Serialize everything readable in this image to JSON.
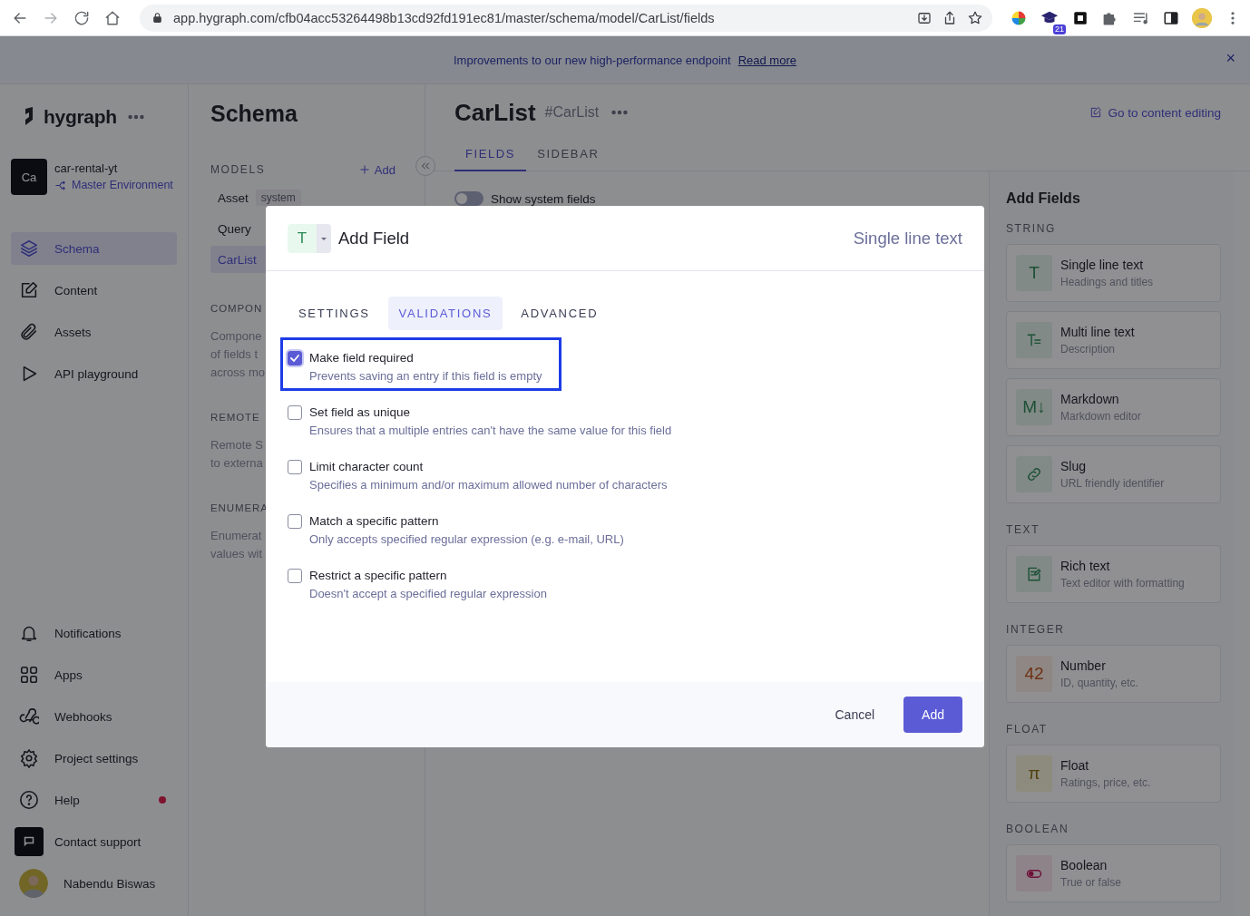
{
  "browser": {
    "url": "app.hygraph.com/cfb04acc53264498b13cd92fd191ec81/master/schema/model/CarList/fields",
    "extension_badge": "21"
  },
  "banner": {
    "text": "Improvements to our new high-performance endpoint",
    "link": "Read more",
    "close": "×"
  },
  "sidebar": {
    "brand": "hygraph",
    "project": {
      "initials": "Ca",
      "name": "car-rental-yt",
      "environment": "Master Environment"
    },
    "nav": [
      {
        "kind": "layers",
        "label": "Schema",
        "selected": true
      },
      {
        "kind": "edit",
        "label": "Content",
        "selected": false
      },
      {
        "kind": "clip",
        "label": "Assets",
        "selected": false
      },
      {
        "kind": "play",
        "label": "API playground",
        "selected": false
      }
    ],
    "footer_nav": [
      {
        "kind": "bell",
        "label": "Notifications",
        "alert": false
      },
      {
        "kind": "apps",
        "label": "Apps",
        "alert": false
      },
      {
        "kind": "webhook",
        "label": "Webhooks",
        "alert": false
      },
      {
        "kind": "gear",
        "label": "Project settings",
        "alert": false
      },
      {
        "kind": "help",
        "label": "Help",
        "alert": true
      },
      {
        "kind": "support",
        "label": "Contact support",
        "alert": false
      }
    ],
    "user": {
      "name": "Nabendu Biswas"
    }
  },
  "schema_panel": {
    "title": "Schema",
    "models_heading": "MODELS",
    "add_label": "Add",
    "models": [
      {
        "name": "Asset",
        "tag": "system",
        "selected": false
      },
      {
        "name": "Query",
        "selected": false
      },
      {
        "name": "CarList",
        "selected": true
      }
    ],
    "sections": [
      {
        "heading": "COMPON",
        "lines": [
          "Compone",
          "of fields t",
          "across mo"
        ]
      },
      {
        "heading": "REMOTE",
        "lines": [
          "Remote S",
          "to externa"
        ]
      },
      {
        "heading": "ENUMERA",
        "lines": [
          "Enumerat",
          "values wit"
        ]
      }
    ]
  },
  "model": {
    "title": "CarList",
    "api_id": "#CarList",
    "content_link": "Go to content editing",
    "tabs": [
      {
        "label": "FIELDS",
        "selected": true
      },
      {
        "label": "SIDEBAR",
        "selected": false
      }
    ],
    "system_fields": {
      "label": "Show system fields",
      "on": false
    }
  },
  "add_fields": {
    "title": "Add Fields",
    "groups": [
      {
        "heading": "STRING",
        "items": [
          {
            "kind": "text",
            "glyph": "T",
            "name": "Single line text",
            "description": "Headings and titles"
          },
          {
            "kind": "multiline",
            "name": "Multi line text",
            "description": "Description"
          },
          {
            "kind": "markdown",
            "glyph": "M↓",
            "name": "Markdown",
            "description": "Markdown editor"
          },
          {
            "kind": "slug",
            "name": "Slug",
            "description": "URL friendly identifier"
          }
        ]
      },
      {
        "heading": "TEXT",
        "items": [
          {
            "kind": "richtext",
            "name": "Rich text",
            "description": "Text editor with formatting"
          }
        ]
      },
      {
        "heading": "INTEGER",
        "items": [
          {
            "kind": "number",
            "glyph": "42",
            "name": "Number",
            "description": "ID, quantity, etc."
          }
        ]
      },
      {
        "heading": "FLOAT",
        "items": [
          {
            "kind": "float",
            "glyph": "π",
            "name": "Float",
            "description": "Ratings, price, etc."
          }
        ]
      },
      {
        "heading": "BOOLEAN",
        "items": [
          {
            "kind": "boolean",
            "name": "Boolean",
            "description": "True or false"
          }
        ]
      }
    ]
  },
  "modal": {
    "type_glyph": "T",
    "title": "Add Field",
    "type_label": "Single line text",
    "tabs": [
      {
        "label": "SETTINGS",
        "selected": false
      },
      {
        "label": "VALIDATIONS",
        "selected": true
      },
      {
        "label": "ADVANCED",
        "selected": false
      }
    ],
    "validations": [
      {
        "label": "Make field required",
        "description": "Prevents saving an entry if this field is empty",
        "checked": true,
        "focused": true
      },
      {
        "label": "Set field as unique",
        "description": "Ensures that a multiple entries can't have the same value for this field",
        "checked": false,
        "focused": false
      },
      {
        "label": "Limit character count",
        "description": "Specifies a minimum and/or maximum allowed number of characters",
        "checked": false,
        "focused": false
      },
      {
        "label": "Match a specific pattern",
        "description": "Only accepts specified regular expression (e.g. e-mail, URL)",
        "checked": false,
        "focused": false
      },
      {
        "label": "Restrict a specific pattern",
        "description": "Doesn't accept a specified regular expression",
        "checked": false,
        "focused": false
      }
    ],
    "cancel": "Cancel",
    "submit": "Add"
  }
}
